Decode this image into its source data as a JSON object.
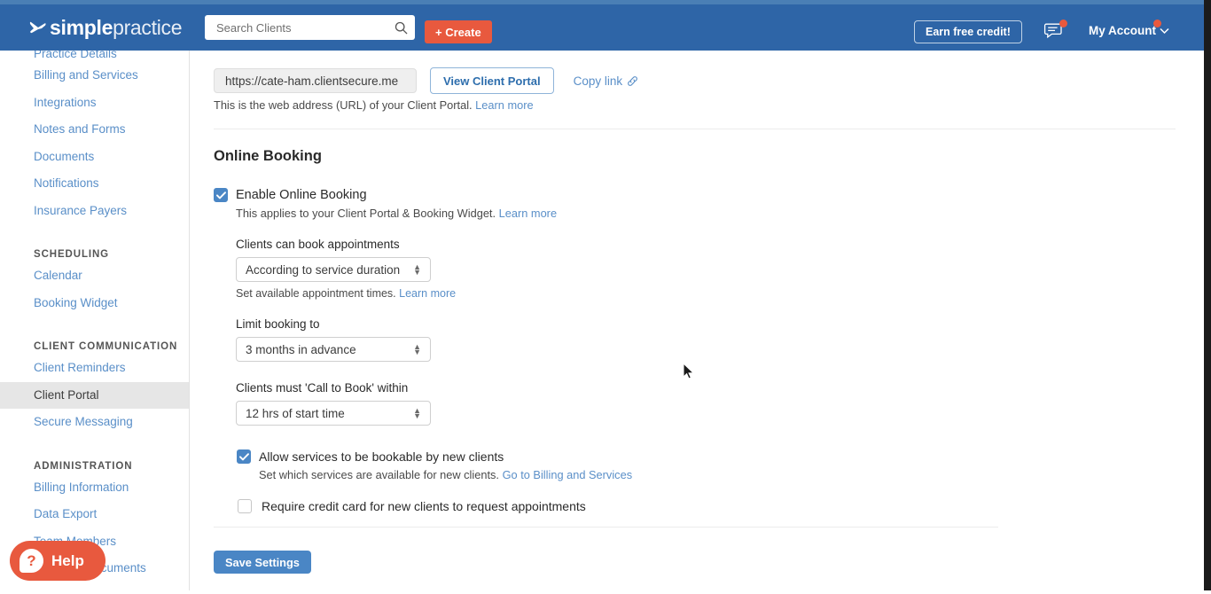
{
  "header": {
    "logo_bold": "simple",
    "logo_light": "practice",
    "logo_icon": "butterfly-icon",
    "search_placeholder": "Search Clients",
    "search_value": "",
    "create_label": "+ Create",
    "earn_credit_label": "Earn free credit!",
    "messages_icon": "message-bubble-icon",
    "my_account_label": "My Account",
    "brand_blue": "#2e65a7",
    "accent_orange": "#e8593e"
  },
  "sidebar": {
    "items": [
      {
        "label": "Practice Details",
        "active": false,
        "clipped": true
      },
      {
        "label": "Billing and Services",
        "active": false
      },
      {
        "label": "Integrations",
        "active": false
      },
      {
        "label": "Notes and Forms",
        "active": false
      },
      {
        "label": "Documents",
        "active": false
      },
      {
        "label": "Notifications",
        "active": false
      },
      {
        "label": "Insurance Payers",
        "active": false
      }
    ],
    "section_scheduling": "SCHEDULING",
    "scheduling_items": [
      {
        "label": "Calendar",
        "active": false
      },
      {
        "label": "Booking Widget",
        "active": false
      }
    ],
    "section_client_communication": "CLIENT COMMUNICATION",
    "client_communication_items": [
      {
        "label": "Client Reminders",
        "active": false
      },
      {
        "label": "Client Portal",
        "active": true
      },
      {
        "label": "Secure Messaging",
        "active": false
      }
    ],
    "section_administration": "ADMINISTRATION",
    "administration_items": [
      {
        "label": "Billing Information",
        "active": false
      },
      {
        "label": "Data Export",
        "active": false
      },
      {
        "label": "Team Members",
        "active": false
      },
      {
        "label": "Business Documents",
        "active": false
      }
    ]
  },
  "help_widget": {
    "label": "Help",
    "glyph": "?",
    "icon": "question-bubble-icon"
  },
  "main": {
    "portal_url": "https://cate-ham.clientsecure.me",
    "view_portal_label": "View Client Portal",
    "copy_link_label": "Copy link",
    "copy_link_icon": "link-icon",
    "url_help_text": "This is the web address (URL) of your Client Portal.",
    "url_help_link": "Learn more",
    "section_title": "Online Booking",
    "enable_online_booking": {
      "label": "Enable Online Booking",
      "checked": true,
      "help_text": "This applies to your Client Portal & Booking Widget.",
      "help_link": "Learn more"
    },
    "fields": [
      {
        "label": "Clients can book appointments",
        "value": "According to service duration",
        "help_text": "Set available appointment times.",
        "help_link": "Learn more"
      },
      {
        "label": "Limit booking to",
        "value": "3 months in advance",
        "help_text": "",
        "help_link": ""
      },
      {
        "label": "Clients must 'Call to Book' within",
        "value": "12 hrs of start time",
        "help_text": "",
        "help_link": ""
      }
    ],
    "allow_services": {
      "label": "Allow services to be bookable by new clients",
      "checked": true,
      "help_text": "Set which services are available for new clients.",
      "help_link": "Go to Billing and Services"
    },
    "require_credit_card": {
      "label": "Require credit card for new clients to request appointments",
      "checked": false
    },
    "save_label": "Save Settings"
  }
}
